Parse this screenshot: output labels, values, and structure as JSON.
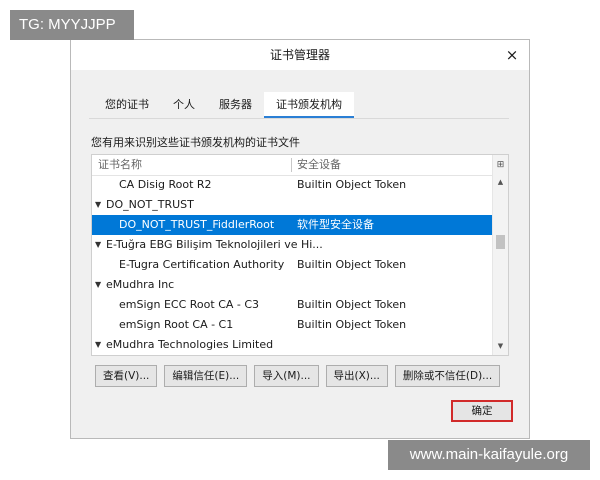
{
  "overlays": {
    "tg_label": "TG: MYYJJPP",
    "watermark": "www.main-kaifayule.org"
  },
  "dialog": {
    "title": "证书管理器",
    "close_glyph": "×",
    "tabs": [
      {
        "label": "您的证书",
        "active": false
      },
      {
        "label": "个人",
        "active": false
      },
      {
        "label": "服务器",
        "active": false
      },
      {
        "label": "证书颁发机构",
        "active": true
      }
    ],
    "description": "您有用来识别这些证书颁发机构的证书文件",
    "tree": {
      "columns": {
        "name": "证书名称",
        "device": "安全设备"
      },
      "rows": [
        {
          "name": "CA Disig Root R2",
          "device": "Builtin Object Token",
          "level": 1,
          "expander": ""
        },
        {
          "name": "DO_NOT_TRUST",
          "device": "",
          "level": 0,
          "expander": "▼"
        },
        {
          "name": "DO_NOT_TRUST_FiddlerRoot",
          "device": "软件型安全设备",
          "level": 1,
          "expander": "",
          "selected": true
        },
        {
          "name": "E-Tuğra EBG Bilişim Teknolojileri ve Hi...",
          "device": "",
          "level": 0,
          "expander": "▼"
        },
        {
          "name": "E-Tugra Certification Authority",
          "device": "Builtin Object Token",
          "level": 1,
          "expander": ""
        },
        {
          "name": "eMudhra Inc",
          "device": "",
          "level": 0,
          "expander": "▼"
        },
        {
          "name": "emSign ECC Root CA - C3",
          "device": "Builtin Object Token",
          "level": 1,
          "expander": ""
        },
        {
          "name": "emSign Root CA - C1",
          "device": "Builtin Object Token",
          "level": 1,
          "expander": ""
        },
        {
          "name": "eMudhra Technologies Limited",
          "device": "",
          "level": 0,
          "expander": "▼"
        }
      ]
    },
    "buttons": {
      "view": "查看(V)...",
      "edit_trust": "编辑信任(E)...",
      "import": "导入(M)...",
      "export": "导出(X)...",
      "delete_distrust": "删除或不信任(D)...",
      "ok": "确定"
    },
    "accent_color": "#0078d7",
    "highlight_color": "#d12a2a"
  }
}
